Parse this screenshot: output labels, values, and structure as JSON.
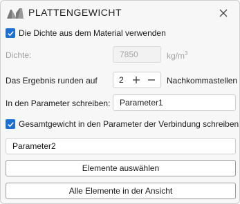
{
  "window": {
    "title": "PLATTENGEWICHT",
    "logo_icon": "brand-logo-icon",
    "close_icon": "close-icon"
  },
  "use_density": {
    "checked": true,
    "label": "Die Dichte aus dem Material verwenden"
  },
  "density": {
    "label": "Dichte:",
    "value": "7850",
    "unit_base": "kg/m",
    "unit_exp": "3"
  },
  "rounding": {
    "label_before": "Das Ergebnis runden auf",
    "value": "2",
    "plus_icon": "plus-icon",
    "minus_icon": "minus-icon",
    "label_after": "Nachkommastellen"
  },
  "parameter": {
    "label": "In den Parameter schreiben:",
    "value": "Parameter1"
  },
  "total_weight": {
    "checked": true,
    "label": "Gesamtgewicht in den Parameter der Verbindung schreiben",
    "value": "Parameter2"
  },
  "buttons": {
    "select_elements": "Elemente auswählen",
    "all_in_view": "Alle Elemente in der Ansicht"
  },
  "colors": {
    "accent": "#1f6fd1",
    "background": "#f7f7f7"
  }
}
